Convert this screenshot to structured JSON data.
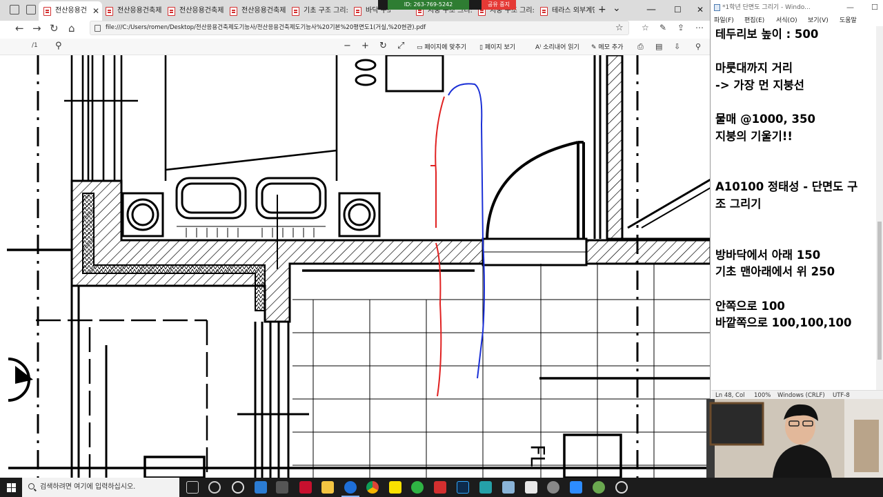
{
  "browser": {
    "tabs": [
      {
        "label": "전산응용건",
        "active": true
      },
      {
        "label": "전산응용건축제",
        "active": false
      },
      {
        "label": "전산응용건축제",
        "active": false
      },
      {
        "label": "전산응용건축제",
        "active": false
      },
      {
        "label": "기초 구조 그리:",
        "active": false
      },
      {
        "label": "바닥 구조 그리:",
        "active": false
      },
      {
        "label": "지붕 구조 그리:",
        "active": false
      },
      {
        "label": "지붕 구조 그리:",
        "active": false
      },
      {
        "label": "테라스 외부계단",
        "active": false
      }
    ],
    "new_tab_glyph": "+",
    "tab_list_glyph": "⌄",
    "url": "file:///C:/Users/romen/Desktop/전산응용건축제도기능사/전산응용건축제도기능사%20기본%20평면도1(거실,%20현관).pdf",
    "pdf_toolbar": {
      "page_indicator": "/1",
      "fit_page": "페이지에 맞추기",
      "page_view": "페이지 보기",
      "read_aloud": "소리내어 읽기",
      "add_note": "메모 추가"
    },
    "zoom_overlay": {
      "meeting_id": "ID: 263-769-5242",
      "stop_share": "공유 중지"
    },
    "window_controls": [
      "—",
      "☐",
      "✕"
    ]
  },
  "notepad": {
    "title": "*1학년 단면도 그리기 - Windo...",
    "window_controls": [
      "—",
      "☐",
      "✕"
    ],
    "menu": [
      "파일(F)",
      "편집(E)",
      "서식(O)",
      "보기(V)",
      "도움말"
    ],
    "lines": [
      "테두리보 높이 : 500",
      "",
      "마룻대까지 거리",
      "-> 가장 먼 지붕선",
      "",
      "물매 @1000, 350",
      "지붕의 기울기!!",
      "",
      "",
      "A10100 정태성 - 단면도 구",
      "조 그리기",
      "",
      "",
      "방바닥에서 아래 150",
      "기초 맨아래에서 위 250",
      "",
      "안쪽으로 100",
      "바깥쪽으로 100,100,100"
    ],
    "status": {
      "position": "Ln 48, Col",
      "zoom": "100%",
      "eol": "Windows (CRLF)",
      "encoding": "UTF-8"
    }
  },
  "taskbar": {
    "search_placeholder": "검색하려면 여기에 입력하십시오.",
    "apps": [
      "task-view",
      "settings",
      "search",
      "mail",
      "store",
      "mcafee",
      "file-explorer",
      "edge",
      "chrome",
      "kakaotalk",
      "green-app",
      "acrobat",
      "photoshop",
      "teal-app",
      "folder-app",
      "photos",
      "zoom",
      "globe-app",
      "clock-app"
    ]
  }
}
